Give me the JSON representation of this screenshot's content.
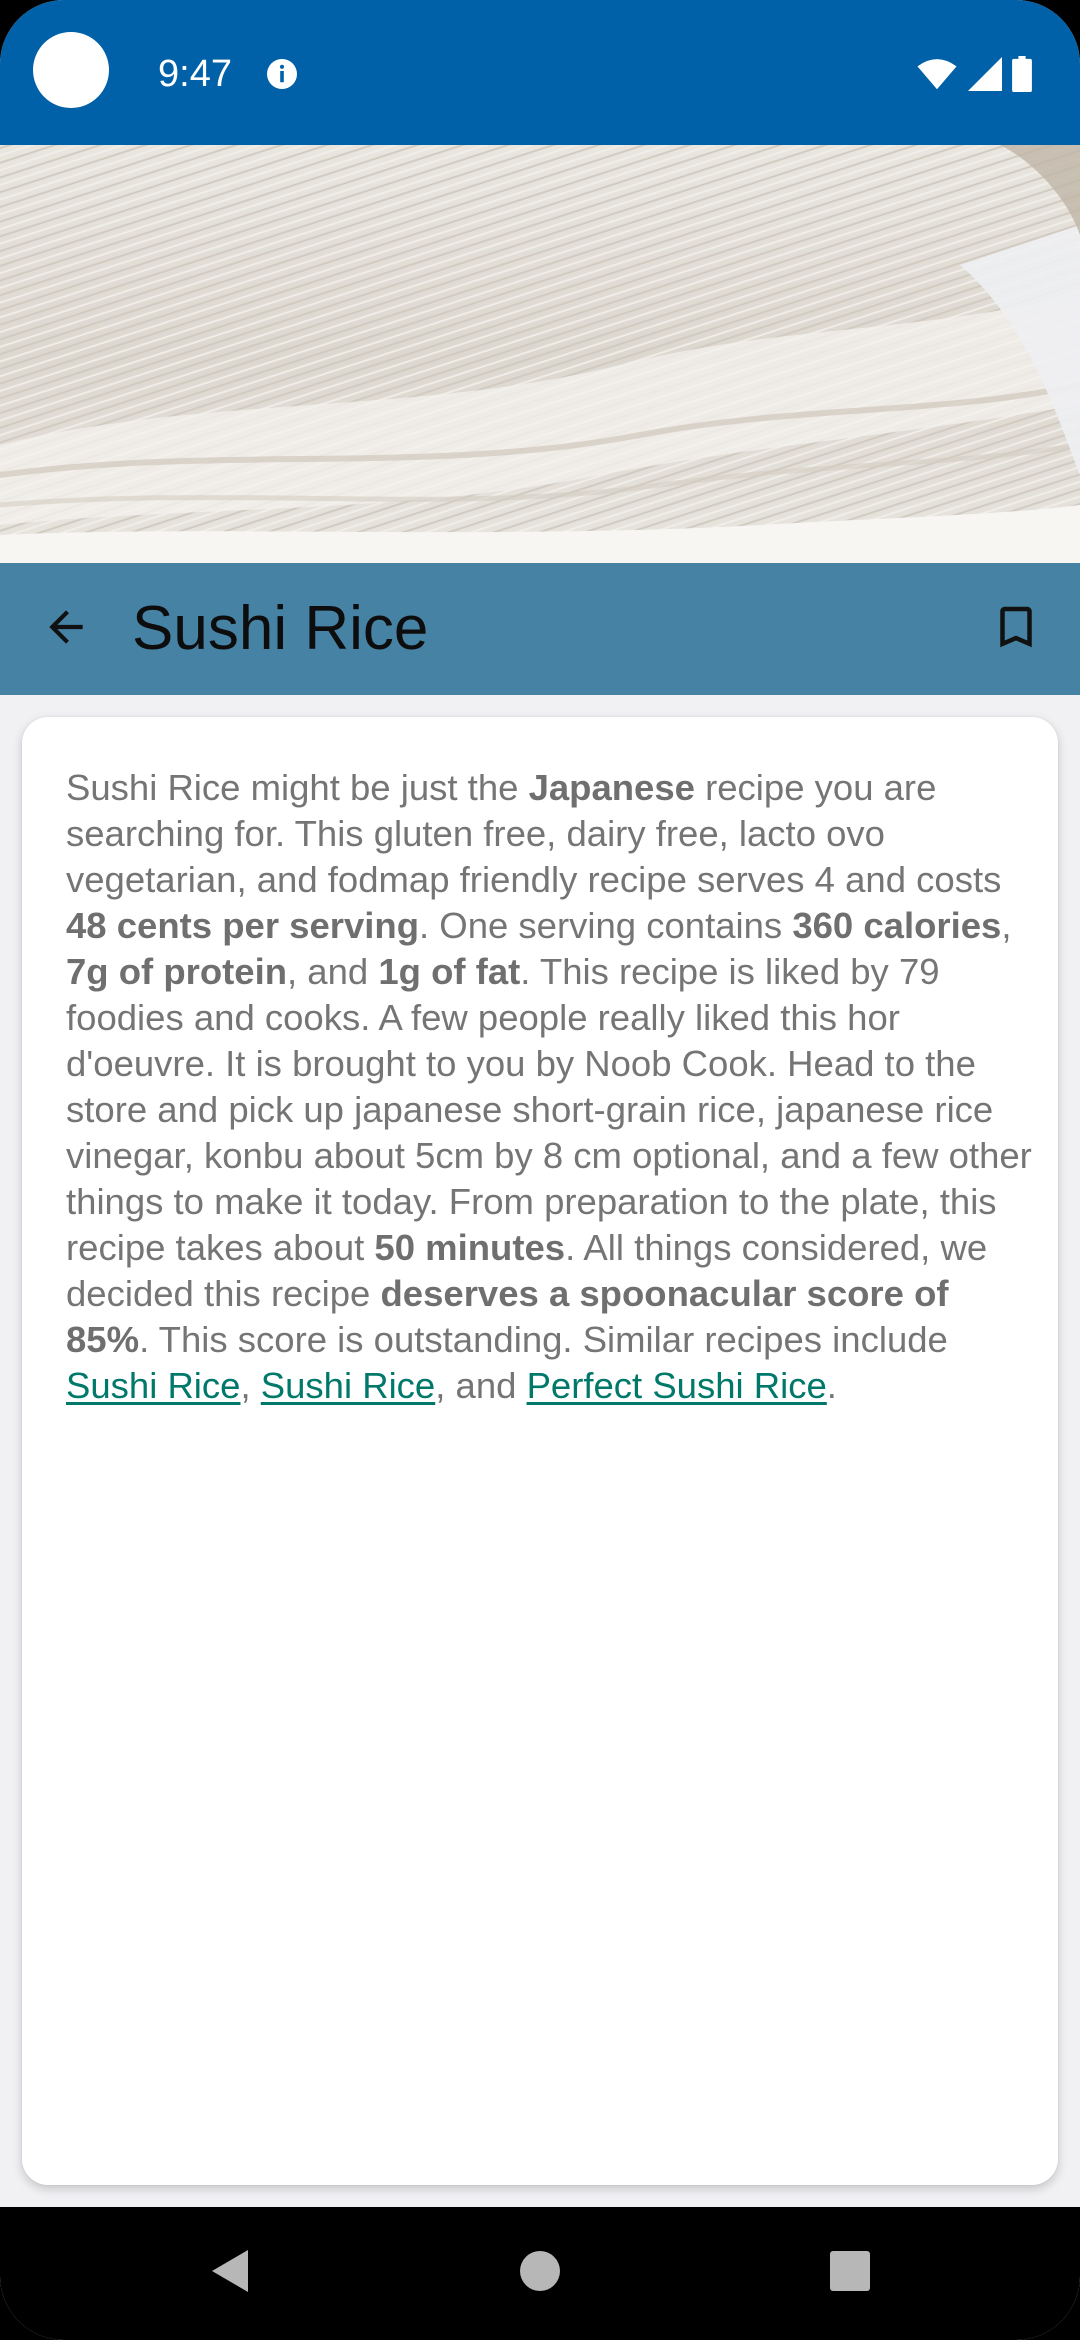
{
  "status_bar": {
    "time": "9:47",
    "bg_color": "#0061a8",
    "icons": [
      "info-icon",
      "wifi-icon",
      "signal-icon",
      "battery-icon"
    ]
  },
  "hero": {
    "icon": "recipe-photo"
  },
  "app_bar": {
    "title": "Sushi Rice",
    "bg_color": "#4582a4",
    "back_icon": "arrow-left-icon",
    "bookmark_icon": "bookmark-outline-icon"
  },
  "summary": {
    "seg_01": "Sushi Rice might be just the ",
    "seg_02": "Japanese",
    "seg_03": " recipe you are searching for. This gluten free, dairy free, lacto ovo vegetarian, and fodmap friendly recipe serves 4 and costs ",
    "seg_04": "48 cents per serving",
    "seg_05": ". One serving contains ",
    "seg_06": "360 calories",
    "seg_07": ", ",
    "seg_08": "7g of protein",
    "seg_09": ", and ",
    "seg_10": "1g of fat",
    "seg_11": ". This recipe is liked by 79 foodies and cooks. A few people really liked this hor d'oeuvre. It is brought to you by Noob Cook. Head to the store and pick up japanese short-grain rice, japanese rice vinegar, konbu about 5cm by 8 cm optional, and a few other things to make it today. From preparation to the plate, this recipe takes about ",
    "seg_12": "50 minutes",
    "seg_13": ". All things considered, we decided this recipe ",
    "seg_14": "deserves a spoonacular score of 85%",
    "seg_15": ". This score is outstanding. Similar recipes include ",
    "link_1": "Sushi Rice",
    "seg_16": ", ",
    "link_2": "Sushi Rice",
    "seg_17": ", and ",
    "link_3": "Perfect Sushi Rice",
    "seg_18": ".",
    "text_color": "#757575",
    "link_color": "#00796b"
  },
  "nav_bar": {
    "back_icon": "nav-back-icon",
    "home_icon": "nav-home-icon",
    "recents_icon": "nav-recents-icon"
  }
}
